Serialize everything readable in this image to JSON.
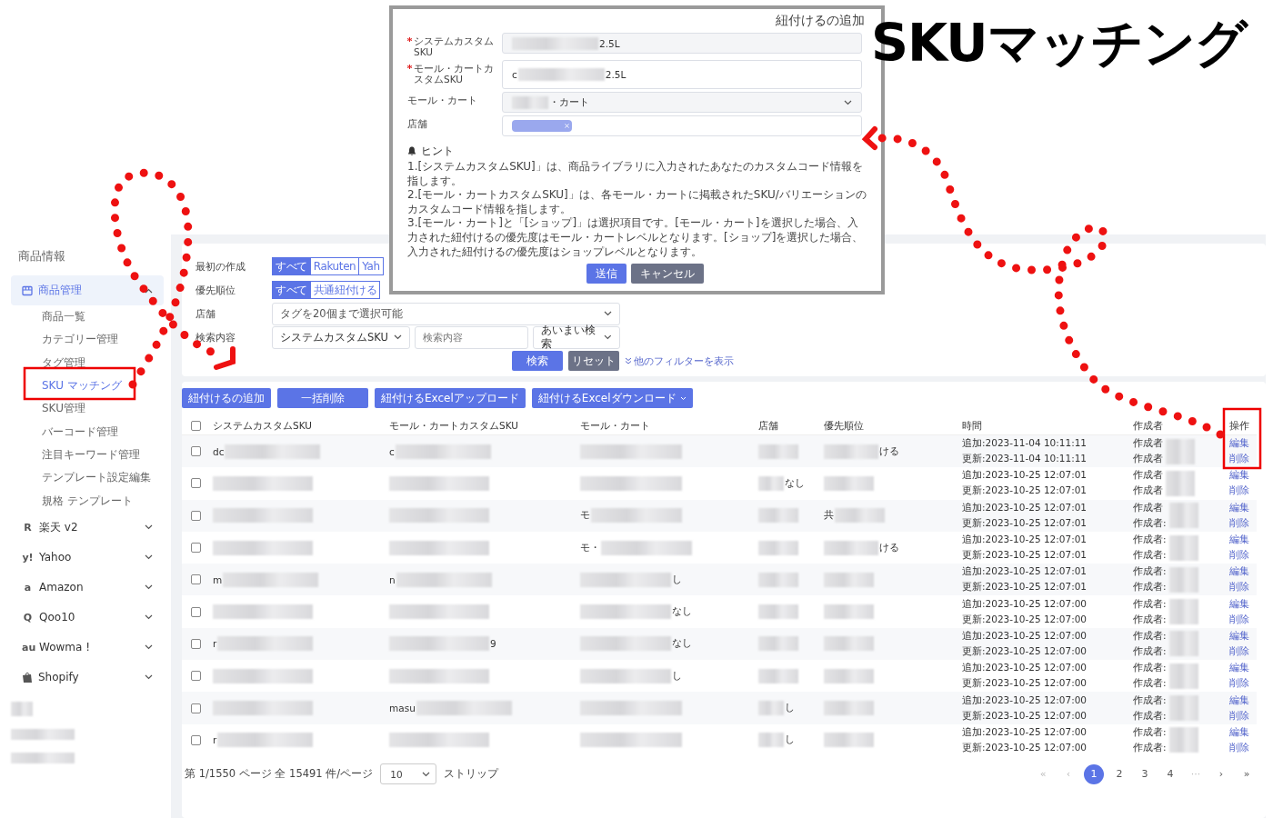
{
  "headline": "SKUマッチング",
  "sidebar": {
    "section": "商品情報",
    "groups": [
      {
        "label": "商品管理",
        "kind": "store",
        "expanded": true,
        "selected": true,
        "children": [
          {
            "label": "商品一覧",
            "selected": false
          },
          {
            "label": "カテゴリー管理",
            "selected": false
          },
          {
            "label": "タグ管理",
            "selected": false
          },
          {
            "label": "SKU マッチング",
            "selected": true
          },
          {
            "label": "SKU管理",
            "selected": false
          },
          {
            "label": "バーコード管理",
            "selected": false
          },
          {
            "label": "注目キーワード管理",
            "selected": false
          },
          {
            "label": "テンプレート設定編集",
            "selected": false
          },
          {
            "label": "規格 テンプレート",
            "selected": false
          }
        ]
      },
      {
        "label": "楽天 v2",
        "kind": "logo",
        "logo": "R",
        "expanded": false,
        "selected": false
      },
      {
        "label": "Yahoo",
        "kind": "logo",
        "logo": "y!",
        "expanded": false,
        "selected": false
      },
      {
        "label": "Amazon",
        "kind": "logo",
        "logo": "a",
        "expanded": false,
        "selected": false
      },
      {
        "label": "Qoo10",
        "kind": "logo",
        "logo": "Q",
        "expanded": false,
        "selected": false
      },
      {
        "label": "Wowma !",
        "kind": "logo",
        "logo": "au",
        "expanded": false,
        "selected": false
      },
      {
        "label": "Shopify",
        "kind": "bag",
        "expanded": false,
        "selected": false
      }
    ]
  },
  "filters": [
    {
      "kind": "segmented",
      "label": "最初の作成",
      "options": [
        {
          "label": "すべて",
          "selected": true
        },
        {
          "label": "Rakuten",
          "selected": false
        },
        {
          "label": "Yah",
          "selected": false
        }
      ]
    },
    {
      "kind": "segmented",
      "label": "優先順位",
      "options": [
        {
          "label": "すべて",
          "selected": true
        },
        {
          "label": "共通紐付ける",
          "selected": false
        }
      ]
    },
    {
      "kind": "tags",
      "label": "店舗",
      "placeholder": "タグを20個まで選択可能"
    },
    {
      "kind": "search",
      "label": "検索内容",
      "field": "システムカスタムSKU",
      "placeholder": "検索内容",
      "mode": "あいまい検索"
    }
  ],
  "filter_actions": {
    "search": "検索",
    "reset": "リセット",
    "more": "他のフィルターを表示"
  },
  "toolbar": [
    {
      "label": "紐付けるの追加",
      "dropdown": false
    },
    {
      "label": "一括削除",
      "dropdown": false
    },
    {
      "label": "紐付けるExcelアップロード",
      "dropdown": false
    },
    {
      "label": "紐付けるExcelダウンロード",
      "dropdown": true
    }
  ],
  "table": {
    "all_checked": false,
    "columns": [
      "システムカスタムSKU",
      "モール・カートカスタムSKU",
      "モール・カート",
      "店舗",
      "優先順位",
      "時間",
      "作成者",
      "操作"
    ],
    "rows": [
      {
        "checked": false,
        "sku": "dc",
        "mall_sku": "c",
        "priority_suffix": "ける",
        "added": "追加:2023-11-04 10:11:11",
        "updated": "更新:2023-11-04 10:11:11",
        "creator_1": "作成者",
        "creator_2": "作成者",
        "actions": [
          "編集",
          "削除"
        ]
      },
      {
        "checked": false,
        "shop": "なし",
        "added": "追加:2023-10-25 12:07:01",
        "updated": "更新:2023-10-25 12:07:01",
        "creator_1": "作成者",
        "creator_2": "作成者",
        "actions": [
          "編集",
          "削除"
        ]
      },
      {
        "checked": false,
        "mall_prefix": "モ",
        "priority_prefix": "共",
        "added": "追加:2023-10-25 12:07:01",
        "updated": "更新:2023-10-25 12:07:01",
        "creator_1": "作成者",
        "creator_2": "作成者:",
        "actions": [
          "編集",
          "削除"
        ]
      },
      {
        "checked": false,
        "mall_prefix": "モ・",
        "priority_suffix": "ける",
        "added": "追加:2023-10-25 12:07:01",
        "updated": "更新:2023-10-25 12:07:01",
        "creator_1": "作成者:",
        "creator_2": "作成者:",
        "actions": [
          "編集",
          "削除"
        ]
      },
      {
        "checked": false,
        "sku": "m",
        "mall_sku": "n",
        "mall_suffix": "し",
        "added": "追加:2023-10-25 12:07:01",
        "updated": "更新:2023-10-25 12:07:01",
        "creator_1": "作成者:",
        "creator_2": "作成者:",
        "actions": [
          "編集",
          "削除"
        ]
      },
      {
        "checked": false,
        "mall_suffix": "なし",
        "added": "追加:2023-10-25 12:07:00",
        "updated": "更新:2023-10-25 12:07:00",
        "creator_1": "作成者:",
        "creator_2": "作成者:",
        "actions": [
          "編集",
          "削除"
        ]
      },
      {
        "checked": false,
        "sku": "r",
        "mall_sku_end": "9",
        "mall_suffix": "なし",
        "added": "追加:2023-10-25 12:07:00",
        "updated": "更新:2023-10-25 12:07:00",
        "creator_1": "作成者:",
        "creator_2": "作成者:",
        "actions": [
          "編集",
          "削除"
        ]
      },
      {
        "checked": false,
        "mall_suffix": "し",
        "added": "追加:2023-10-25 12:07:00",
        "updated": "更新:2023-10-25 12:07:00",
        "creator_1": "作成者:",
        "creator_2": "作成者:",
        "actions": [
          "編集",
          "削除"
        ]
      },
      {
        "checked": false,
        "mall_sku": "masu",
        "shop": "し",
        "added": "追加:2023-10-25 12:07:00",
        "updated": "更新:2023-10-25 12:07:00",
        "creator_1": "作成者:",
        "creator_2": "作成者:",
        "actions": [
          "編集",
          "削除"
        ]
      },
      {
        "checked": false,
        "sku": "r",
        "shop": "し",
        "added": "追加:2023-10-25 12:07:00",
        "updated": "更新:2023-10-25 12:07:00",
        "creator_1": "作成者:",
        "creator_2": "作成者:",
        "actions": [
          "編集",
          "削除"
        ]
      }
    ]
  },
  "pagination": {
    "summary": "第 1/1550 ページ 全 15491 件/ページ",
    "page_size": "10",
    "suffix": "ストリップ",
    "first": "«",
    "prev": "‹",
    "pages": [
      {
        "label": "1",
        "selected": true
      },
      {
        "label": "2",
        "selected": false
      },
      {
        "label": "3",
        "selected": false
      },
      {
        "label": "4",
        "selected": false
      }
    ],
    "ellipsis": "···",
    "next": "›",
    "last": "»"
  },
  "modal": {
    "title": "紐付けるの追加",
    "fields": [
      {
        "kind": "input",
        "label": "システムカスタムSKU",
        "required": true,
        "value": "2.5L"
      },
      {
        "kind": "textarea",
        "label": "モール・カートカスタムSKU",
        "required": true,
        "prefix": "c",
        "value": "2.5L"
      },
      {
        "kind": "select",
        "label": "モール・カート",
        "required": false,
        "value": "・カート"
      },
      {
        "kind": "tags",
        "label": "店舗",
        "required": false
      }
    ],
    "hint_title": "ヒント",
    "hints": [
      "1.[システムカスタムSKU]」は、商品ライブラリに入力されたあなたのカスタムコード情報を指します。",
      "2.[モール・カートカスタムSKU]」は、各モール・カートに掲載されたSKU/バリエーションのカスタムコード情報を指します。",
      "3.[モール・カート]と「[ショップ]」は選択項目です。[モール・カート]を選択した場合、入力された紐付けるの優先度はモール・カートレベルとなります。[ショップ]を選択した場合、入力された紐付けるの優先度はショップレベルとなります。"
    ],
    "submit": "送信",
    "cancel": "キャンセル"
  }
}
